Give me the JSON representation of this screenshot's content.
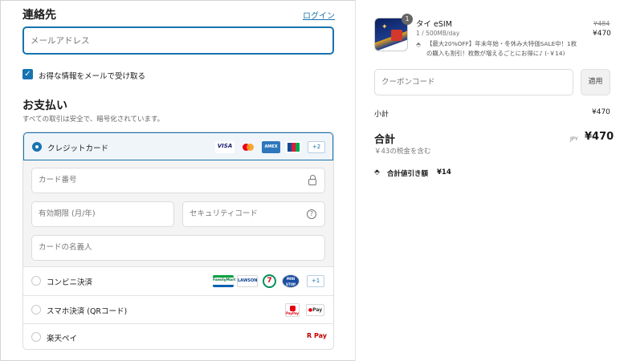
{
  "contact": {
    "title": "連絡先",
    "login_link": "ログイン",
    "email_placeholder": "メールアドレス",
    "newsletter_label": "お得な情報をメールで受け取る",
    "newsletter_checked": true
  },
  "payment": {
    "title": "お支払い",
    "subtitle": "すべての取引は安全で、暗号化されています。",
    "credit_card": {
      "label": "クレジットカード",
      "selected": true,
      "brands": [
        "VISA",
        "Mastercard",
        "AMEX",
        "JCB"
      ],
      "more": "+2",
      "card_number_placeholder": "カード番号",
      "expiry_placeholder": "有効期限 (月/年)",
      "security_code_placeholder": "セキュリティコード",
      "name_placeholder": "カードの名義人"
    },
    "konbini": {
      "label": "コンビニ決済",
      "brands": [
        "FamilyMart",
        "LAWSON",
        "7",
        "MINI STOP"
      ],
      "more": "+1"
    },
    "smartphone": {
      "label": "スマホ決済 (QRコード)",
      "brands": [
        "PayPay",
        "Pay"
      ]
    },
    "rakuten": {
      "label": "楽天ペイ",
      "brand": "R Pay"
    }
  },
  "summary": {
    "item": {
      "quantity": "1",
      "name": "タイ eSIM",
      "variant": "1 / 500MB/day",
      "discount_note_line1": "【最大20%OFF】年末年始・冬休み大特価SALE中！1枚",
      "discount_note_line2": "の購入も割引！枚数が増えるごとにお得に♪ (-￥14)",
      "original_price": "¥484",
      "price": "¥470"
    },
    "coupon_placeholder": "クーポンコード",
    "apply_label": "適用",
    "subtotal_label": "小計",
    "subtotal_value": "¥470",
    "total_label": "合計",
    "currency": "JPY",
    "total_value": "¥470",
    "tax_note": "￥43の税金を含む",
    "discount_label": "合計値引き額",
    "discount_value": "¥14"
  },
  "colors": {
    "accent": "#1773b0",
    "border": "#dcdcdc"
  }
}
